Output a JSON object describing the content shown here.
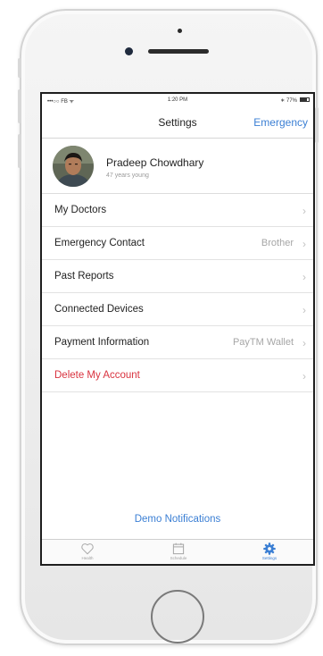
{
  "status_bar": {
    "carrier": "•••○○ FB ᯤ",
    "time": "1:20 PM",
    "battery": "∗ 77%"
  },
  "nav": {
    "title": "Settings",
    "action": "Emergency"
  },
  "profile": {
    "name": "Pradeep Chowdhary",
    "subtitle": "47 years young"
  },
  "menu": [
    {
      "label": "My Doctors",
      "value": "",
      "chevron": "›"
    },
    {
      "label": "Emergency Contact",
      "value": "Brother",
      "chevron": "›"
    },
    {
      "label": "Past Reports",
      "value": "",
      "chevron": "›"
    },
    {
      "label": "Connected Devices",
      "value": "",
      "chevron": "›"
    },
    {
      "label": "Payment Information",
      "value": "PayTM Wallet",
      "chevron": "›"
    },
    {
      "label": "Delete My Account",
      "value": "",
      "chevron": "›"
    }
  ],
  "demo_link": "Demo Notifications",
  "tabs": [
    {
      "label": "Health",
      "icon": "heart-icon"
    },
    {
      "label": "Schedule",
      "icon": "calendar-icon"
    },
    {
      "label": "Settings",
      "icon": "gear-icon"
    }
  ],
  "colors": {
    "accent": "#3b7fd4",
    "danger": "#d9333f"
  }
}
